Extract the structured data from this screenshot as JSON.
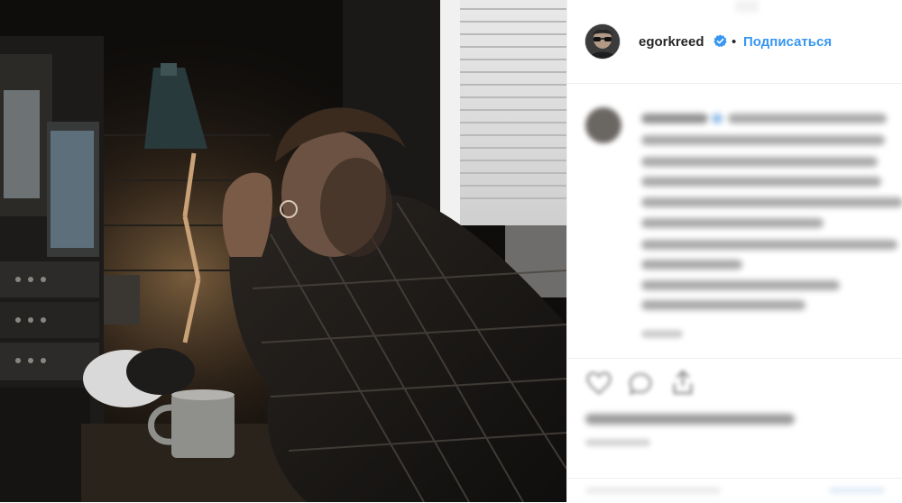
{
  "post": {
    "photo_icon": "photo",
    "username": "egorkreed",
    "verified_icon": "verified-badge-icon",
    "separator": "•",
    "follow_label": "Подписаться"
  },
  "actions": {
    "like_icon": "heart-icon",
    "comment_icon": "comment-icon",
    "share_icon": "share-icon"
  },
  "colors": {
    "accent": "#3897f0",
    "text": "#262626",
    "border": "#efefef"
  }
}
